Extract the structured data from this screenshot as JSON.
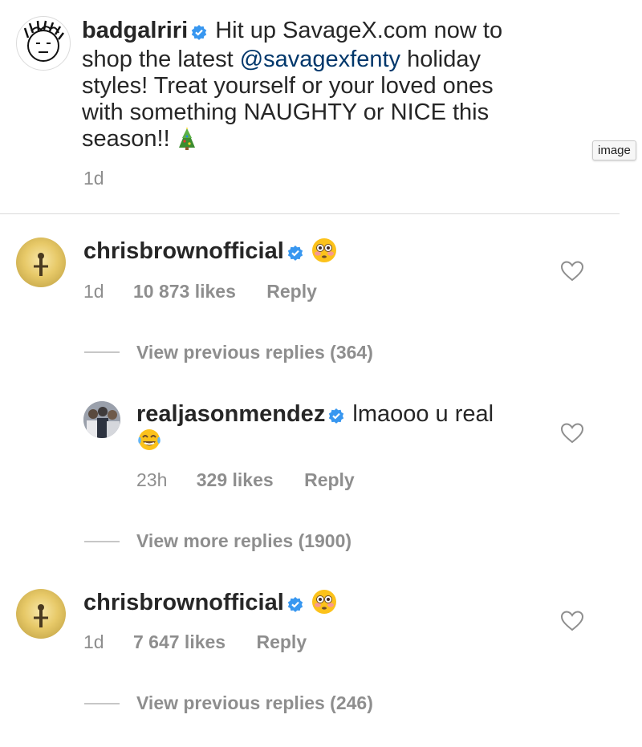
{
  "post": {
    "username": "badgalriri",
    "caption_part1": "Hit up SavageX.com now to shop the latest ",
    "mention": "@savagexfenty",
    "caption_part2": " holiday styles! Treat yourself or your loved ones with something NAUGHTY or NICE this season!!",
    "caption_emoji": "christmas-tree-emoji",
    "time": "1d"
  },
  "tooltip": "image",
  "comments": [
    {
      "username": "chrisbrownofficial",
      "emoji": "flushed-face-emoji",
      "time": "1d",
      "likes": "10 873 likes",
      "reply_label": "Reply",
      "view_replies": "View previous replies (364)"
    },
    {
      "username": "chrisbrownofficial",
      "emoji": "flushed-face-emoji",
      "time": "1d",
      "likes": "7 647 likes",
      "reply_label": "Reply",
      "view_replies": "View previous replies (246)"
    }
  ],
  "reply": {
    "username": "realjasonmendez",
    "text": "lmaooo u real",
    "emoji": "tears-of-joy-emoji",
    "time": "23h",
    "likes": "329 likes",
    "reply_label": "Reply",
    "view_more": "View more replies (1900)"
  },
  "colors": {
    "text": "#262626",
    "muted": "#8e8e8e",
    "mention": "#00376b",
    "verified": "#3897f0"
  }
}
